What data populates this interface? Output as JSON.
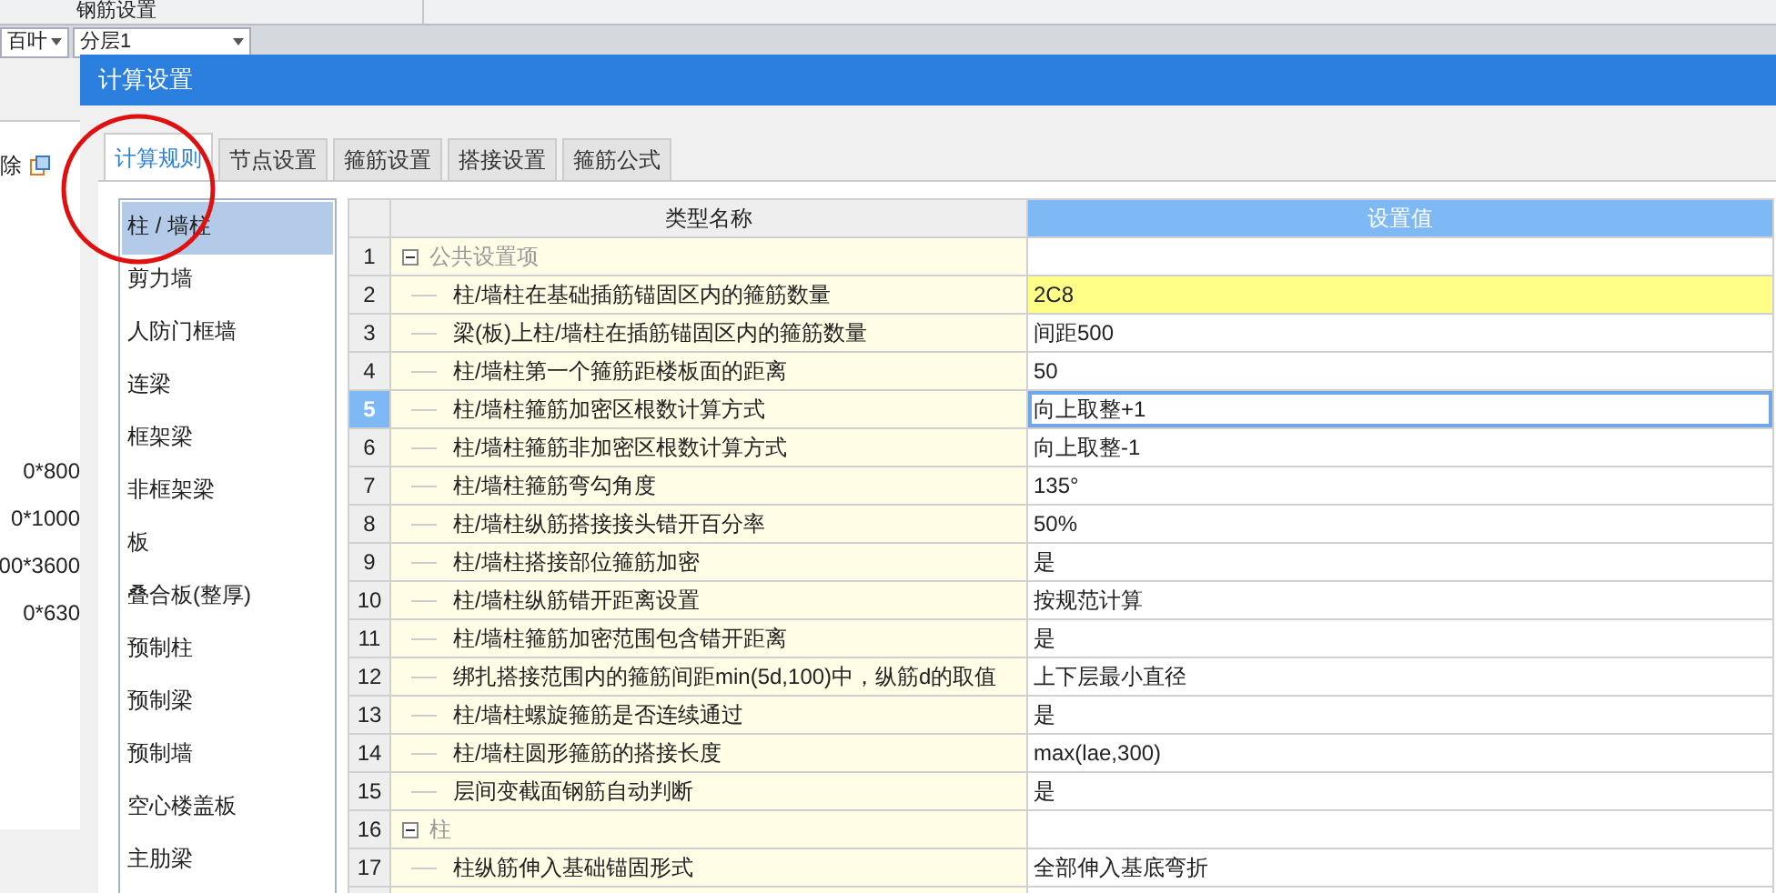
{
  "app": {
    "ribbon_label": "钢筋设置",
    "toolbar": [
      {
        "value": "百叶"
      },
      {
        "value": "分层1"
      }
    ],
    "delete_label": "除",
    "sizes": [
      "0*800",
      "0*1000",
      "00*3600",
      "0*630"
    ]
  },
  "dialog": {
    "title": "计算设置",
    "tabs": [
      {
        "label": "计算规则",
        "selected": true
      },
      {
        "label": "节点设置",
        "selected": false
      },
      {
        "label": "箍筋设置",
        "selected": false
      },
      {
        "label": "搭接设置",
        "selected": false
      },
      {
        "label": "箍筋公式",
        "selected": false
      }
    ],
    "categories": [
      {
        "label": "柱 / 墙柱",
        "selected": true
      },
      {
        "label": "剪力墙",
        "selected": false
      },
      {
        "label": "人防门框墙",
        "selected": false
      },
      {
        "label": "连梁",
        "selected": false
      },
      {
        "label": "框架梁",
        "selected": false
      },
      {
        "label": "非框架梁",
        "selected": false
      },
      {
        "label": "板",
        "selected": false
      },
      {
        "label": "叠合板(整厚)",
        "selected": false
      },
      {
        "label": "预制柱",
        "selected": false
      },
      {
        "label": "预制梁",
        "selected": false
      },
      {
        "label": "预制墙",
        "selected": false
      },
      {
        "label": "空心楼盖板",
        "selected": false
      },
      {
        "label": "主肋梁",
        "selected": false
      }
    ],
    "table": {
      "columns": [
        "类型名称",
        "设置值"
      ],
      "rows": [
        {
          "kind": "group",
          "number": "1",
          "name": "公共设置项",
          "expanded": true,
          "selected": false,
          "modified": false
        },
        {
          "kind": "item",
          "number": "2",
          "name": "柱/墙柱在基础插筋锚固区内的箍筋数量",
          "value": "2C8",
          "selected": false,
          "modified": true
        },
        {
          "kind": "item",
          "number": "3",
          "name": "梁(板)上柱/墙柱在插筋锚固区内的箍筋数量",
          "value": "间距500",
          "selected": false,
          "modified": false
        },
        {
          "kind": "item",
          "number": "4",
          "name": "柱/墙柱第一个箍筋距楼板面的距离",
          "value": "50",
          "selected": false,
          "modified": false
        },
        {
          "kind": "item",
          "number": "5",
          "name": "柱/墙柱箍筋加密区根数计算方式",
          "value": "向上取整+1",
          "selected": true,
          "modified": false
        },
        {
          "kind": "item",
          "number": "6",
          "name": "柱/墙柱箍筋非加密区根数计算方式",
          "value": "向上取整-1",
          "selected": false,
          "modified": false
        },
        {
          "kind": "item",
          "number": "7",
          "name": "柱/墙柱箍筋弯勾角度",
          "value": "135°",
          "selected": false,
          "modified": false
        },
        {
          "kind": "item",
          "number": "8",
          "name": "柱/墙柱纵筋搭接接头错开百分率",
          "value": "50%",
          "selected": false,
          "modified": false
        },
        {
          "kind": "item",
          "number": "9",
          "name": "柱/墙柱搭接部位箍筋加密",
          "value": "是",
          "selected": false,
          "modified": false
        },
        {
          "kind": "item",
          "number": "10",
          "name": "柱/墙柱纵筋错开距离设置",
          "value": "按规范计算",
          "selected": false,
          "modified": false
        },
        {
          "kind": "item",
          "number": "11",
          "name": "柱/墙柱箍筋加密范围包含错开距离",
          "value": "是",
          "selected": false,
          "modified": false
        },
        {
          "kind": "item",
          "number": "12",
          "name": "绑扎搭接范围内的箍筋间距min(5d,100)中，纵筋d的取值",
          "value": "上下层最小直径",
          "selected": false,
          "modified": false
        },
        {
          "kind": "item",
          "number": "13",
          "name": "柱/墙柱螺旋箍筋是否连续通过",
          "value": "是",
          "selected": false,
          "modified": false
        },
        {
          "kind": "item",
          "number": "14",
          "name": "柱/墙柱圆形箍筋的搭接长度",
          "value": "max(lae,300)",
          "selected": false,
          "modified": false
        },
        {
          "kind": "item",
          "number": "15",
          "name": "层间变截面钢筋自动判断",
          "value": "是",
          "selected": false,
          "modified": false
        },
        {
          "kind": "group",
          "number": "16",
          "name": "柱",
          "expanded": true,
          "selected": false,
          "modified": false
        },
        {
          "kind": "item",
          "number": "17",
          "name": "柱纵筋伸入基础锚固形式",
          "value": "全部伸入基底弯折",
          "selected": false,
          "modified": false
        }
      ]
    }
  }
}
